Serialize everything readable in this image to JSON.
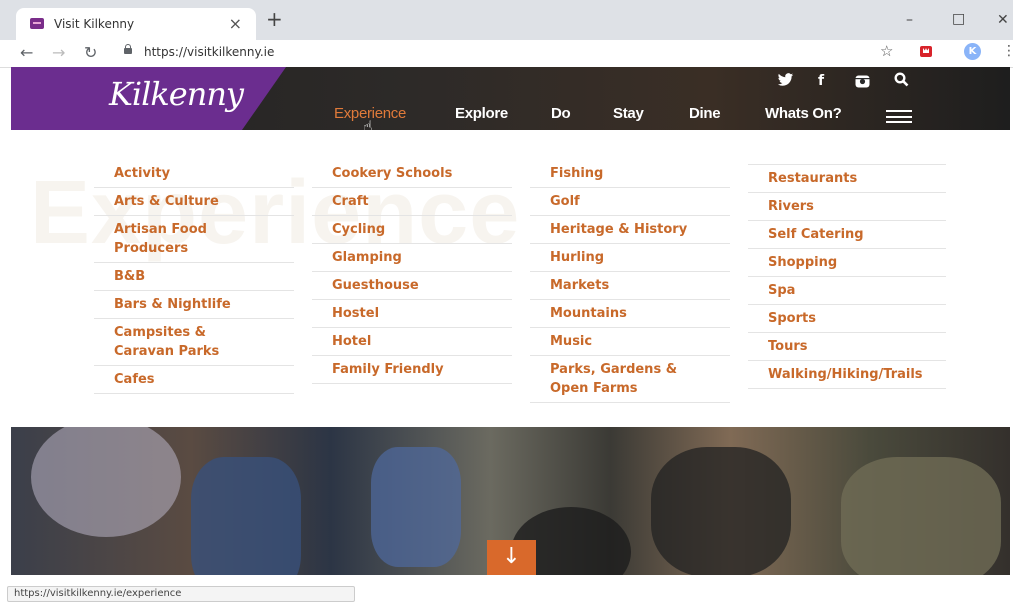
{
  "browser": {
    "tab_title": "Visit Kilkenny",
    "tab_close": "×",
    "new_tab": "+",
    "url": "https://visitkilkenny.ie",
    "profile_initial": "K",
    "status_url": "https://visitkilkenny.ie/experience"
  },
  "site": {
    "logo_text": "Kilkenny",
    "accent_color": "#d9692b",
    "brand_purple": "#6b2d8f",
    "nav": [
      "Experience",
      "Explore",
      "Do",
      "Stay",
      "Dine",
      "Whats On?"
    ],
    "active_nav": "Experience",
    "watermark": "Experience"
  },
  "mega_menu": {
    "col1": [
      "Activity",
      "Arts & Culture",
      "Artisan Food Producers",
      "B&B",
      "Bars & Nightlife",
      "Campsites & Caravan Parks",
      "Cafes"
    ],
    "col2": [
      "Cookery Schools",
      "Craft",
      "Cycling",
      "Glamping",
      "Guesthouse",
      "Hostel",
      "Hotel",
      "Family Friendly"
    ],
    "col3": [
      "Fishing",
      "Golf",
      "Heritage & History",
      "Hurling",
      "Markets",
      "Mountains",
      "Music",
      "Parks, Gardens & Open Farms"
    ],
    "col4": [
      "Restaurants",
      "Rivers",
      "Self Catering",
      "Shopping",
      "Spa",
      "Sports",
      "Tours",
      "Walking/Hiking/Trails"
    ]
  },
  "icons": {
    "social": [
      "twitter-icon",
      "facebook-icon",
      "instagram-icon",
      "search-icon"
    ],
    "scroll": "arrow-down-icon"
  }
}
